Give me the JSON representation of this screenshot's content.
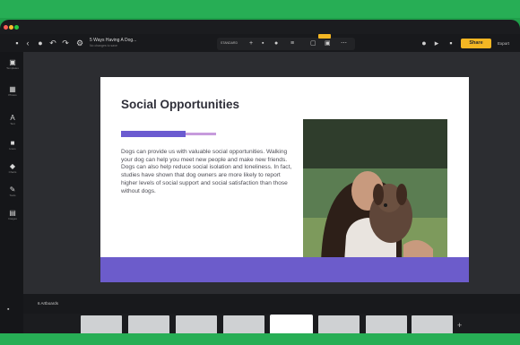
{
  "app": {
    "doc_title": "5 Ways Having A Dog...",
    "doc_subtitle": "No changes to save",
    "share_label": "Share",
    "export_label": "Export"
  },
  "topbar_icons": [
    "back-arrow-icon",
    "undo-icon",
    "redo-icon",
    "settings-icon",
    "comment-icon",
    "present-icon",
    "bell-icon"
  ],
  "sidebar": {
    "items": [
      {
        "icon": "templates-icon",
        "label": "Templates"
      },
      {
        "icon": "photos-icon",
        "label": "Photos"
      },
      {
        "icon": "text-icon",
        "label": "Text"
      },
      {
        "icon": "icons-icon",
        "label": "Icons"
      },
      {
        "icon": "charts-icon",
        "label": "Charts"
      },
      {
        "icon": "tools-icon",
        "label": "Tools"
      },
      {
        "icon": "images-icon",
        "label": "Images"
      }
    ]
  },
  "context_toolbar": {
    "label": "STANDARD"
  },
  "slide": {
    "title": "Social Opportunities",
    "body": "Dogs can provide us with valuable social opportunities. Walking your dog can help you meet new people and make new friends. Dogs can also help reduce social isolation and loneliness. In fact, studies have shown that dog owners are more likely to report higher levels of social support and social satisfaction than those without dogs.",
    "accent_color": "#6c5ccb",
    "accent_secondary": "#c79bdc",
    "photo": "woman-hugging-dog-photo"
  },
  "artboards": {
    "label": "6 Artboards",
    "count": 8,
    "active_index": 4
  },
  "colors": {
    "frame_green": "#27ae55",
    "share_button": "#f4b623",
    "editor_background": "#2c2d31"
  }
}
